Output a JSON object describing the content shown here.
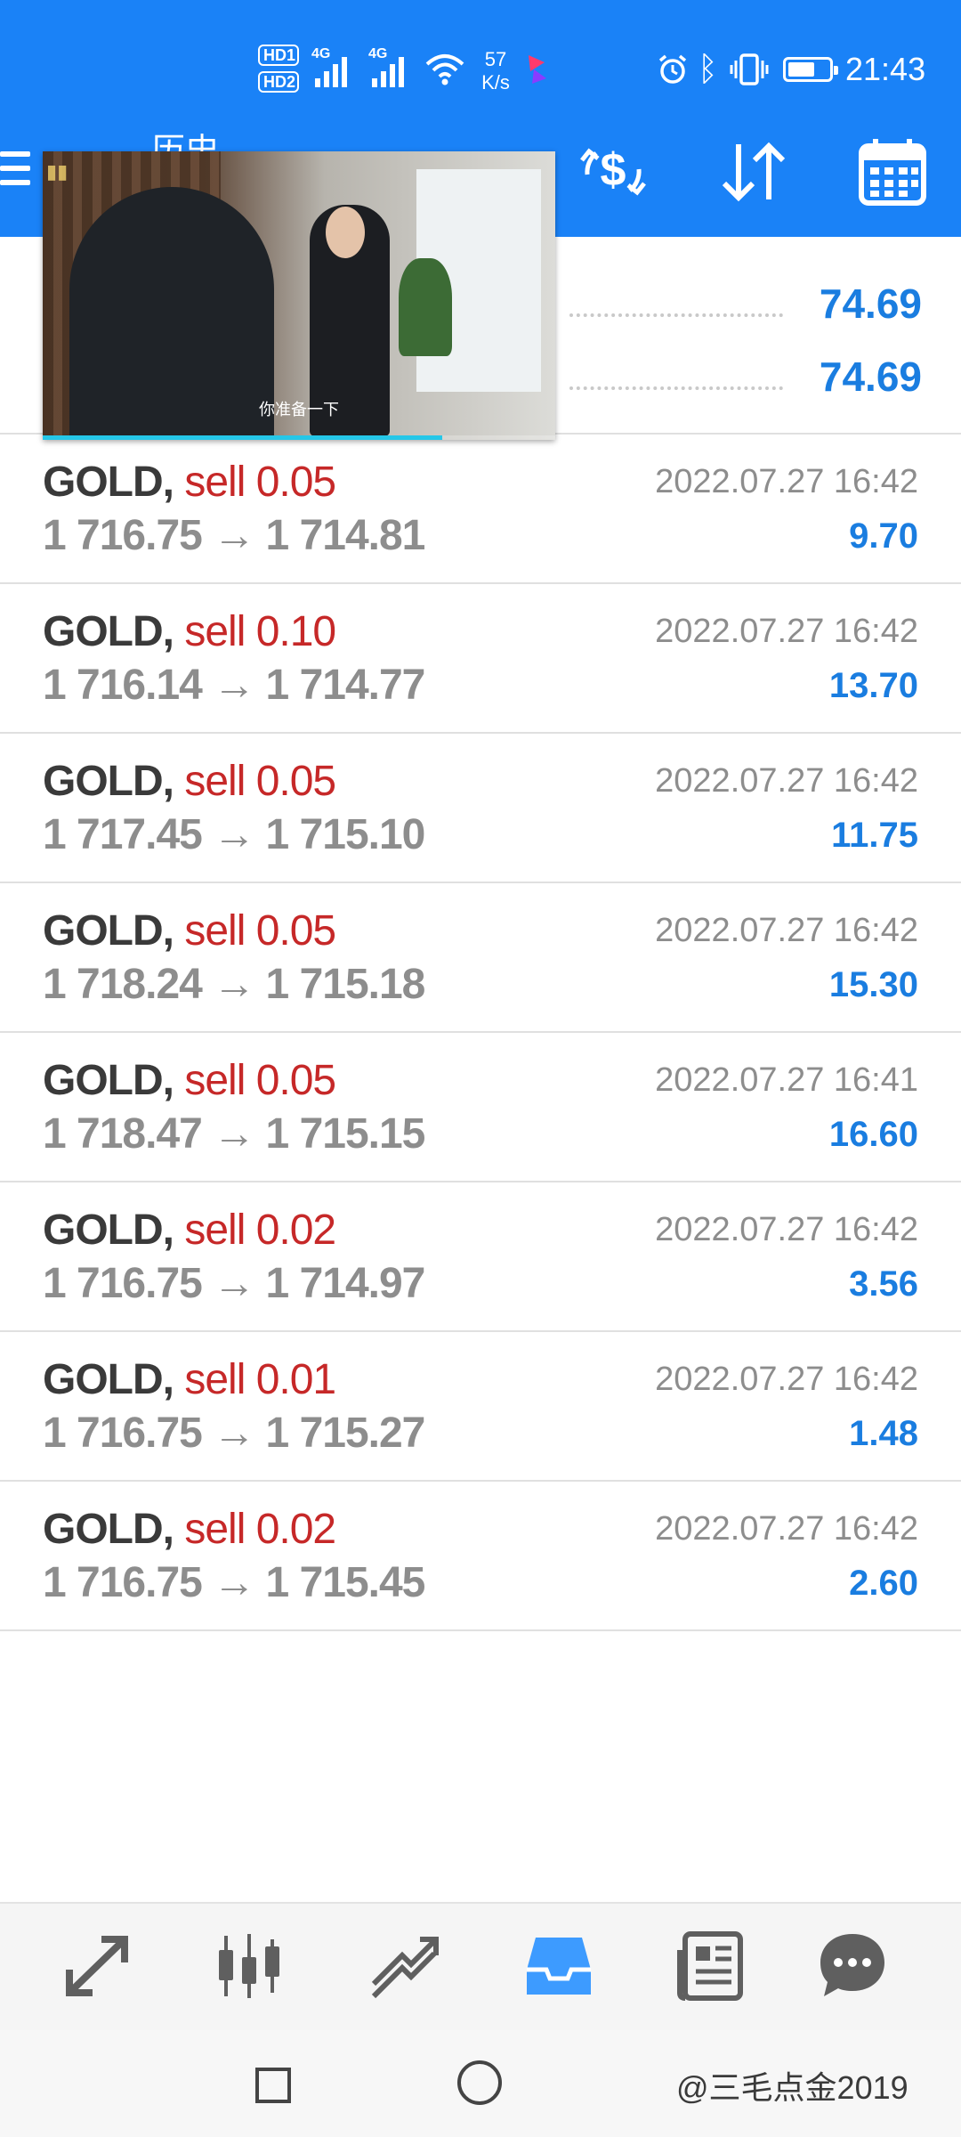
{
  "status_bar": {
    "hd1": "HD1",
    "hd2": "HD2",
    "net1": "4G",
    "net2": "4G",
    "speed_value": "57",
    "speed_unit": "K/s",
    "time": "21:43"
  },
  "app_bar": {
    "title": "历史",
    "icons": [
      "menu-icon",
      "dollar-exchange-icon",
      "sort-icon",
      "calendar-icon"
    ]
  },
  "summary": {
    "rows": [
      {
        "value": "74.69"
      },
      {
        "value": "74.69"
      }
    ]
  },
  "video_overlay": {
    "caption": "你准备一下",
    "progress": 0.78
  },
  "trades": [
    {
      "symbol": "GOLD,",
      "side": "sell 0.05",
      "open": "1 716.75",
      "arrow": "→",
      "close": "1 714.81",
      "time": "2022.07.27 16:42",
      "profit": "9.70"
    },
    {
      "symbol": "GOLD,",
      "side": "sell 0.10",
      "open": "1 716.14",
      "arrow": "→",
      "close": "1 714.77",
      "time": "2022.07.27 16:42",
      "profit": "13.70"
    },
    {
      "symbol": "GOLD,",
      "side": "sell 0.05",
      "open": "1 717.45",
      "arrow": "→",
      "close": "1 715.10",
      "time": "2022.07.27 16:42",
      "profit": "11.75"
    },
    {
      "symbol": "GOLD,",
      "side": "sell 0.05",
      "open": "1 718.24",
      "arrow": "→",
      "close": "1 715.18",
      "time": "2022.07.27 16:42",
      "profit": "15.30"
    },
    {
      "symbol": "GOLD,",
      "side": "sell 0.05",
      "open": "1 718.47",
      "arrow": "→",
      "close": "1 715.15",
      "time": "2022.07.27 16:41",
      "profit": "16.60"
    },
    {
      "symbol": "GOLD,",
      "side": "sell 0.02",
      "open": "1 716.75",
      "arrow": "→",
      "close": "1 714.97",
      "time": "2022.07.27 16:42",
      "profit": "3.56"
    },
    {
      "symbol": "GOLD,",
      "side": "sell 0.01",
      "open": "1 716.75",
      "arrow": "→",
      "close": "1 715.27",
      "time": "2022.07.27 16:42",
      "profit": "1.48"
    },
    {
      "symbol": "GOLD,",
      "side": "sell 0.02",
      "open": "1 716.75",
      "arrow": "→",
      "close": "1 715.45",
      "time": "2022.07.27 16:42",
      "profit": "2.60"
    }
  ],
  "bottom_tabs": [
    {
      "icon": "quotes-icon",
      "active": false
    },
    {
      "icon": "chart-icon",
      "active": false
    },
    {
      "icon": "trade-icon",
      "active": false
    },
    {
      "icon": "history-icon",
      "active": true
    },
    {
      "icon": "news-icon",
      "active": false
    },
    {
      "icon": "chat-icon",
      "active": false
    }
  ],
  "colors": {
    "accent": "#1a82f7",
    "sell": "#c62828",
    "profit": "#1a7de0",
    "muted": "#8d8d8d",
    "active_tab": "#3d9bff",
    "inactive_tab": "#5f5f5f"
  },
  "watermark": "@三毛点金2019"
}
